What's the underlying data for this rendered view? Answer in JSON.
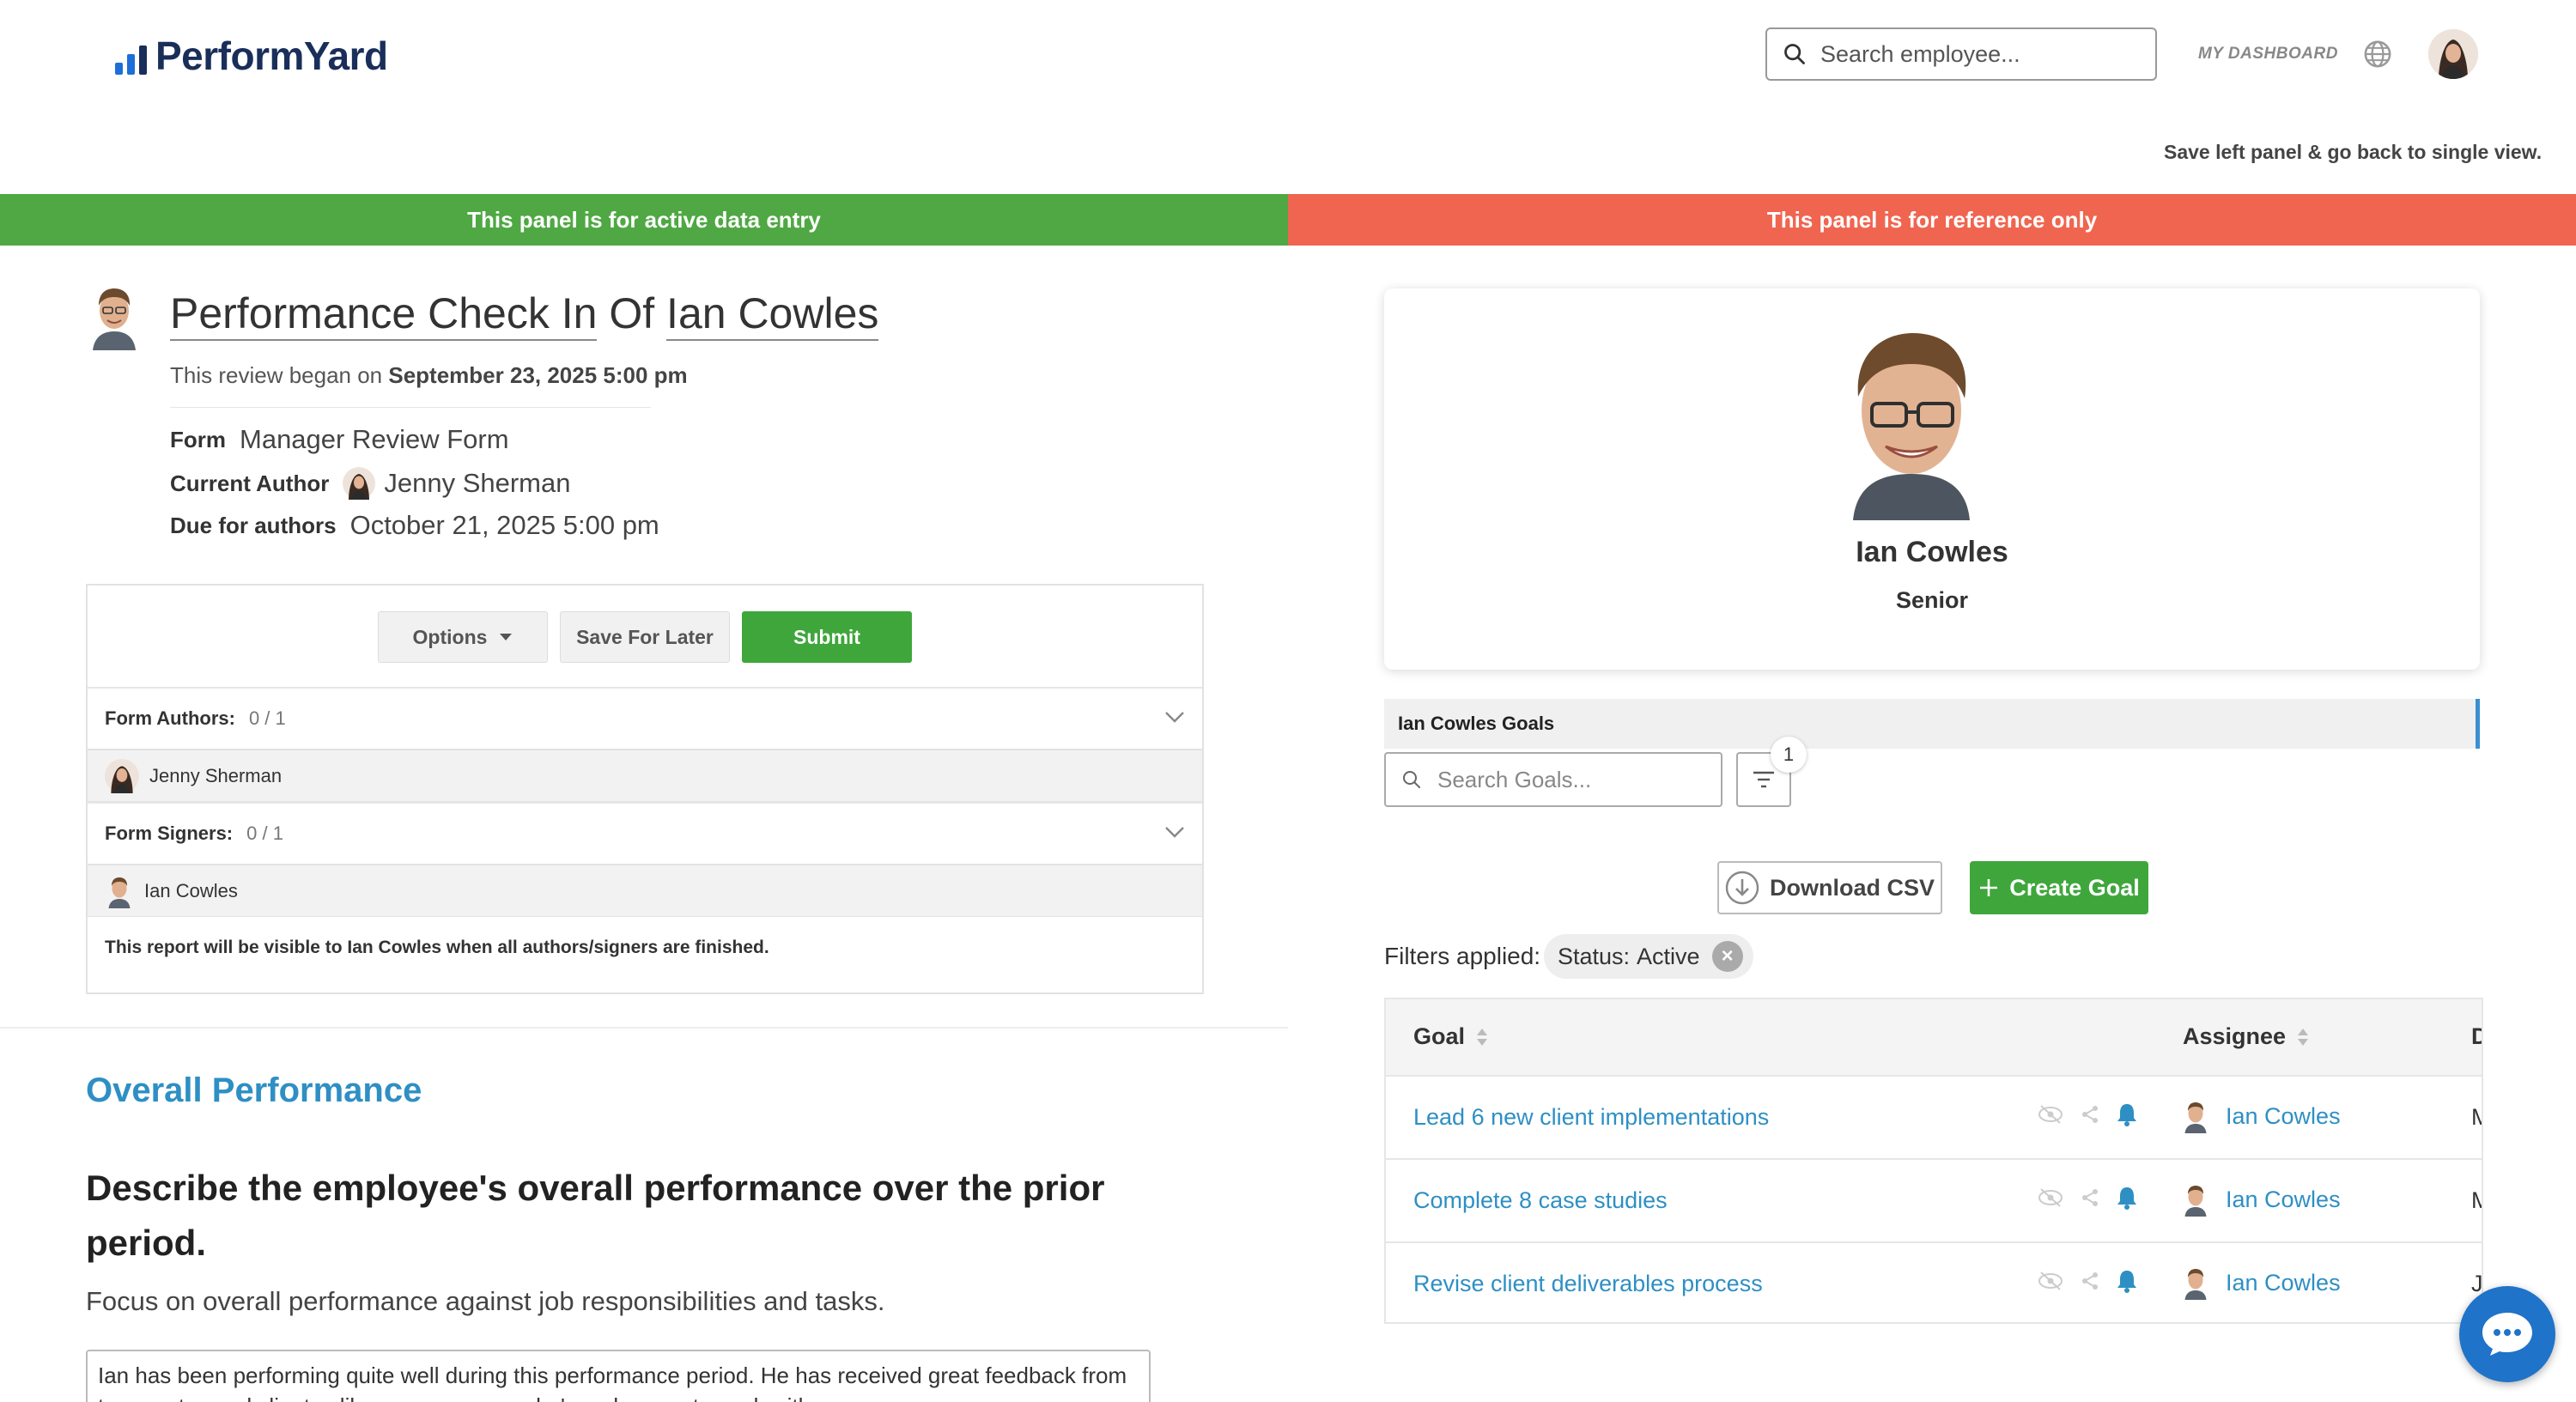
{
  "header": {
    "logo_text": "PerformYard",
    "search_placeholder": "Search employee...",
    "my_dashboard": "MY DASHBOARD",
    "save_left_panel": "Save left panel & go back to single view."
  },
  "banners": {
    "left": "This panel is for active data entry",
    "right": "This panel is for reference only"
  },
  "review": {
    "title_prefix": "Performance Check In",
    "title_of": "Of",
    "employee_name": "Ian Cowles",
    "began_text": "This review began on",
    "began_date": "September 23, 2025 5:00 pm",
    "form_label": "Form",
    "form_value": "Manager Review Form",
    "author_label": "Current Author",
    "author_value": "Jenny Sherman",
    "due_label": "Due for authors",
    "due_value": "October 21, 2025 5:00 pm"
  },
  "form_card": {
    "options_label": "Options",
    "save_later_label": "Save For Later",
    "submit_label": "Submit",
    "authors_label": "Form Authors:",
    "authors_count": "0 / 1",
    "author_name": "Jenny Sherman",
    "signers_label": "Form Signers:",
    "signers_count": "0 / 1",
    "signer_name": "Ian Cowles",
    "visibility_note": "This report will be visible to Ian Cowles when all authors/signers are finished."
  },
  "section": {
    "title": "Overall Performance",
    "question": "Describe the employee's overall performance over the prior period.",
    "hint": "Focus on overall performance against job responsibilities and tasks.",
    "answer": "Ian has been performing quite well during this performance period. He has received great feedback from teammates and clients alike; everyone says he's a pleasure to work with."
  },
  "profile": {
    "name": "Ian Cowles",
    "role": "Senior"
  },
  "goals": {
    "bar_title": "Ian Cowles Goals",
    "search_placeholder": "Search Goals...",
    "filter_count": "1",
    "download_csv": "Download CSV",
    "create_goal": "Create Goal",
    "filters_applied_label": "Filters applied:",
    "chip_key": "Status:",
    "chip_value": "Active",
    "columns": {
      "goal": "Goal",
      "assignee": "Assignee",
      "due_cut": "D"
    },
    "rows": [
      {
        "goal": "Lead 6 new client implementations",
        "assignee": "Ian Cowles",
        "due_cut": "M"
      },
      {
        "goal": "Complete 8 case studies",
        "assignee": "Ian Cowles",
        "due_cut": "M"
      },
      {
        "goal": "Revise client deliverables process",
        "assignee": "Ian Cowles",
        "due_cut": "J"
      }
    ]
  },
  "colors": {
    "green_banner": "#4fa843",
    "red_banner": "#f06550",
    "link_blue": "#2e8fc4",
    "brand_navy": "#1a2e5a"
  },
  "icons": [
    "logo-bars-icon",
    "search-icon",
    "globe-icon",
    "avatar",
    "caret-down-icon",
    "chevron-down-icon",
    "filter-icon",
    "download-icon",
    "plus-icon",
    "close-icon",
    "hidden-eye-icon",
    "share-icon",
    "bell-icon",
    "sort-icon",
    "chat-icon"
  ]
}
